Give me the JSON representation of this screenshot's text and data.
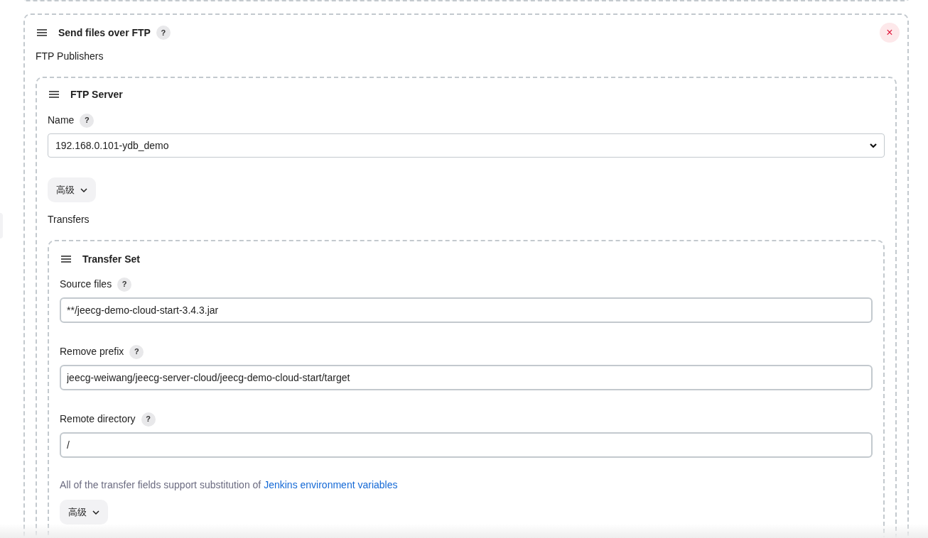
{
  "step": {
    "title": "Send files over FTP",
    "help": "?",
    "close": "×",
    "publishers_label": "FTP Publishers",
    "server": {
      "title": "FTP Server",
      "name_field": {
        "label": "Name",
        "help": "?",
        "value": "192.168.0.101-ydb_demo"
      },
      "advanced": "高级",
      "transfers_label": "Transfers",
      "transfer_set": {
        "title": "Transfer Set",
        "fields": [
          {
            "label": "Source files",
            "help": "?",
            "value": "**/jeecg-demo-cloud-start-3.4.3.jar"
          },
          {
            "label": "Remove prefix",
            "help": "?",
            "value": "jeecg-weiwang/jeecg-server-cloud/jeecg-demo-cloud-start/target"
          },
          {
            "label": "Remote directory",
            "help": "?",
            "value": "/"
          }
        ],
        "note": "All of the transfer fields support substitution of",
        "note_link": "Jenkins environment variables",
        "advanced": "高级"
      }
    }
  }
}
